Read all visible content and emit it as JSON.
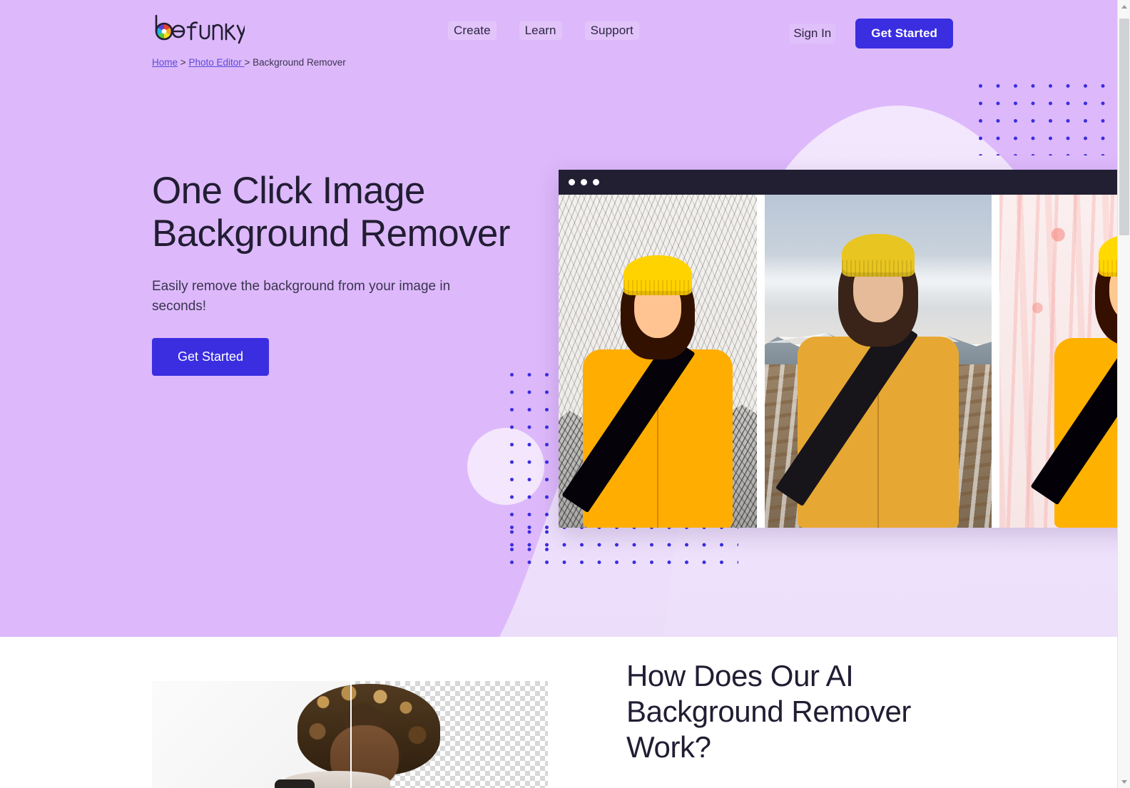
{
  "brand": {
    "name": "befunky",
    "logo_colors": [
      "#e8402a",
      "#f5a623",
      "#f2e01c",
      "#5ac63a",
      "#1fb6e8",
      "#5a3fd6",
      "#c83ab0"
    ]
  },
  "theme": {
    "hero_background": "#ddb9fb",
    "wave_fill": "#f1e4fd",
    "accent_blue": "#3a2ee0",
    "dot_color": "#3a2ee0",
    "text_dark": "#221d33",
    "chrome_dark": "#221f33"
  },
  "nav": {
    "links": [
      {
        "label": "Create"
      },
      {
        "label": "Learn"
      },
      {
        "label": "Support"
      }
    ],
    "sign_in_label": "Sign In",
    "get_started_label": "Get Started"
  },
  "breadcrumb": {
    "items": [
      {
        "label": "Home",
        "link": true
      },
      {
        "label": "Photo Editor ",
        "link": true
      },
      {
        "label": "Background Remover",
        "link": false
      }
    ],
    "separator": ">"
  },
  "hero": {
    "title": "One Click Image Background Remover",
    "subtitle": "Easily remove the background from your image in seconds!",
    "cta_label": "Get Started"
  },
  "browser_mock": {
    "window_dots": 3,
    "screenshots": [
      {
        "name": "sketch-effect-preview",
        "style": "pencil-sketch"
      },
      {
        "name": "original-photo-preview",
        "style": "original-photo"
      },
      {
        "name": "pink-splatter-preview",
        "style": "pink-splatter"
      }
    ]
  },
  "section_two": {
    "heading": "How Does Our AI Background Remover Work?",
    "before_after": {
      "name": "before-after-comparison",
      "left_label": "before",
      "right_label": "after-transparent"
    }
  },
  "scrollbar": {
    "up_icon": "chevron-up-icon",
    "down_icon": "chevron-down-icon"
  }
}
